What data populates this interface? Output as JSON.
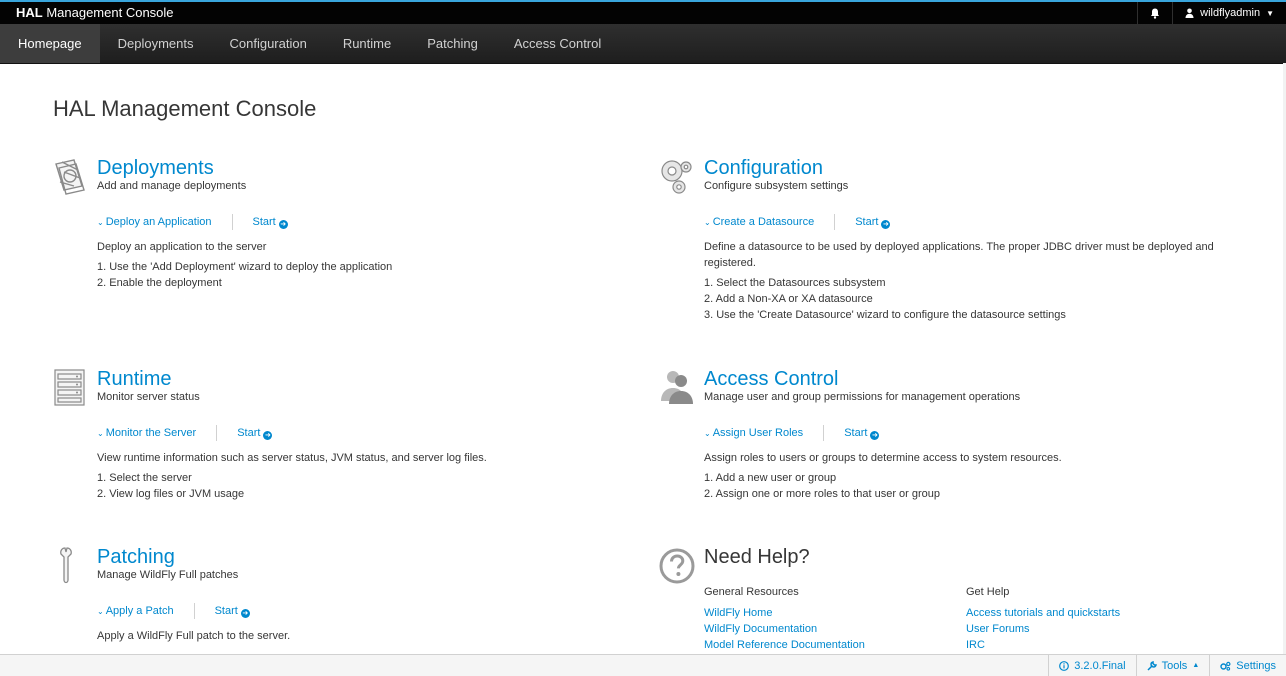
{
  "header": {
    "brand_bold": "HAL",
    "brand_rest": " Management Console",
    "username": "wildflyadmin"
  },
  "nav": {
    "items": [
      {
        "label": "Homepage",
        "active": true
      },
      {
        "label": "Deployments"
      },
      {
        "label": "Configuration"
      },
      {
        "label": "Runtime"
      },
      {
        "label": "Patching"
      },
      {
        "label": "Access Control"
      }
    ]
  },
  "page": {
    "title": "HAL Management Console"
  },
  "deployments": {
    "title": "Deployments",
    "subtitle": "Add and manage deployments",
    "action": "Deploy an Application",
    "start": "Start",
    "description": "Deploy an application to the server",
    "steps": [
      "1. Use the 'Add Deployment' wizard to deploy the application",
      "2. Enable the deployment"
    ]
  },
  "configuration": {
    "title": "Configuration",
    "subtitle": "Configure subsystem settings",
    "action": "Create a Datasource",
    "start": "Start",
    "description_1": "Define a datasource to be used by deployed applications. The proper JDBC driver must be deployed and",
    "description_2": "registered.",
    "steps": [
      "1. Select the Datasources subsystem",
      "2. Add a Non-XA or XA datasource",
      "3. Use the 'Create Datasource' wizard to configure the datasource settings"
    ]
  },
  "runtime": {
    "title": "Runtime",
    "subtitle": "Monitor server status",
    "action": "Monitor the Server",
    "start": "Start",
    "description": "View runtime information such as server status, JVM status, and server log files.",
    "steps": [
      "1. Select the server",
      "2. View log files or JVM usage"
    ]
  },
  "access_control": {
    "title": "Access Control",
    "subtitle": "Manage user and group permissions for management operations",
    "action": "Assign User Roles",
    "start": "Start",
    "description": "Assign roles to users or groups to determine access to system resources.",
    "steps": [
      "1. Add a new user or group",
      "2. Assign one or more roles to that user or group"
    ]
  },
  "patching": {
    "title": "Patching",
    "subtitle": "Manage WildFly Full patches",
    "action": "Apply a Patch",
    "start": "Start",
    "description": "Apply a WildFly Full patch to the server."
  },
  "help": {
    "title": "Need Help?",
    "general_header": "General Resources",
    "general_links": [
      "WildFly Home",
      "WildFly Documentation",
      "Model Reference Documentation"
    ],
    "get_header": "Get Help",
    "get_links": [
      "Access tutorials and quickstarts",
      "User Forums",
      "IRC"
    ]
  },
  "footer": {
    "version": "3.2.0.Final",
    "tools": "Tools",
    "settings": "Settings"
  },
  "colors": {
    "accent": "#0088ce",
    "topbar": "#030303",
    "navbar": "#292929",
    "active_tab": "#3d3d3d"
  },
  "icons": [
    "bell-icon",
    "user-icon",
    "deployments-icon",
    "gears-icon",
    "server-rack-icon",
    "users-icon",
    "wrench-icon",
    "question-circle-icon",
    "info-icon",
    "cog-icon"
  ]
}
